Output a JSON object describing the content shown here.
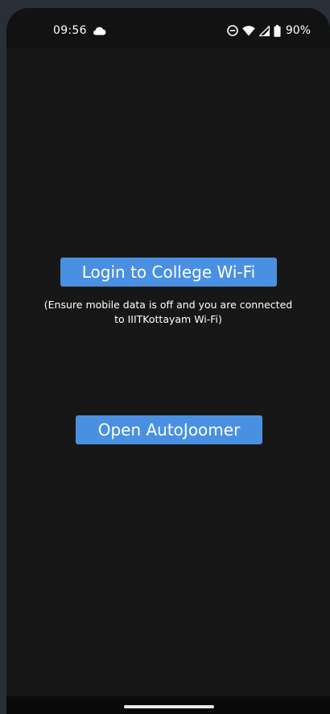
{
  "status_bar": {
    "time": "09:56",
    "battery_percent": "90%",
    "icons": [
      "cloud-icon",
      "do-not-disturb-icon",
      "wifi-icon",
      "cell-signal-icon",
      "battery-icon"
    ]
  },
  "main": {
    "login_button_label": "Login to College Wi-Fi",
    "login_hint": "(Ensure mobile data is off and you are connected to IIITKottayam Wi-Fi)",
    "autojoomer_button_label": "Open AutoJoomer"
  },
  "colors": {
    "button_bg": "#4a90e2",
    "screen_bg": "#171717",
    "text": "#ffffff"
  }
}
